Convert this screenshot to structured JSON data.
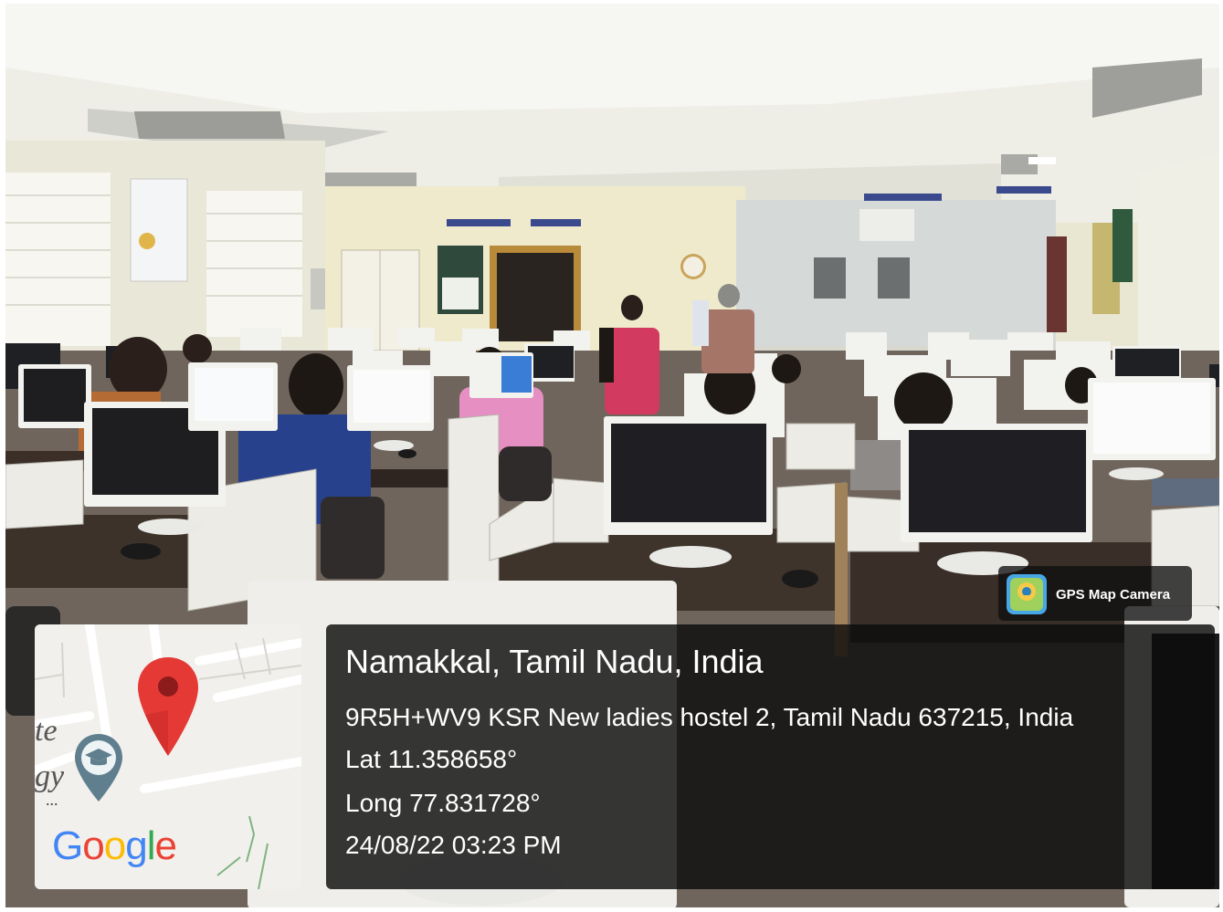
{
  "location": {
    "city_line": "Namakkal, Tamil Nadu, India",
    "address": "9R5H+WV9 KSR New ladies hostel 2, Tamil Nadu 637215, India",
    "latitude": "Lat 11.358658°",
    "longitude": "Long 77.831728°",
    "timestamp": "24/08/22 03:23 PM"
  },
  "badge": {
    "label": "GPS Map Camera",
    "icon": "gps-map-camera-icon"
  },
  "map": {
    "brand": "Google",
    "brand_colors": [
      "#4285F4",
      "#EA4335",
      "#FBBC05",
      "#4285F4",
      "#34A853",
      "#EA4335"
    ],
    "pin_color": "#E53935",
    "place_icon": "graduation-cap-icon",
    "partial_labels": [
      "te",
      "gy",
      "..."
    ]
  },
  "scene": {
    "description_type": "computer-lab-photo"
  }
}
